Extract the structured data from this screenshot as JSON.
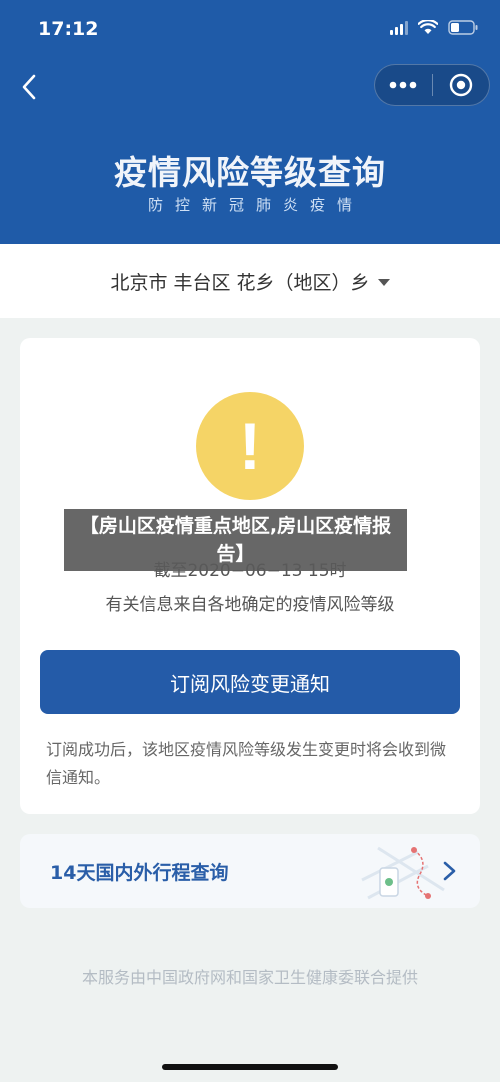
{
  "status_bar": {
    "time": "17:12"
  },
  "header": {
    "title": "疫情风险等级查询",
    "subtitle": "防控新冠肺炎疫情",
    "background_color": "#1f5ba8"
  },
  "nav": {
    "back_icon": "chevron-left-icon",
    "more_icon": "more-dots-icon",
    "close_icon": "target-circle-icon"
  },
  "location": {
    "text": "北京市 丰台区 花乡（地区）乡"
  },
  "risk_card": {
    "level_label": "",
    "as_of": "截至2020−06−13 15时",
    "source": "有关信息来自各地确定的疫情风险等级",
    "subscribe_button": "订阅风险变更通知",
    "subscribe_note": "订阅成功后，该地区疫情风险等级发生变更时将会收到微信通知。",
    "warning_color": "#f5d466"
  },
  "trip_query": {
    "label": "14天国内外行程查询"
  },
  "footer": {
    "text": "本服务由中国政府网和国家卫生健康委联合提供"
  },
  "overlay": {
    "headline": "【房山区疫情重点地区,房山区疫情报告】"
  }
}
